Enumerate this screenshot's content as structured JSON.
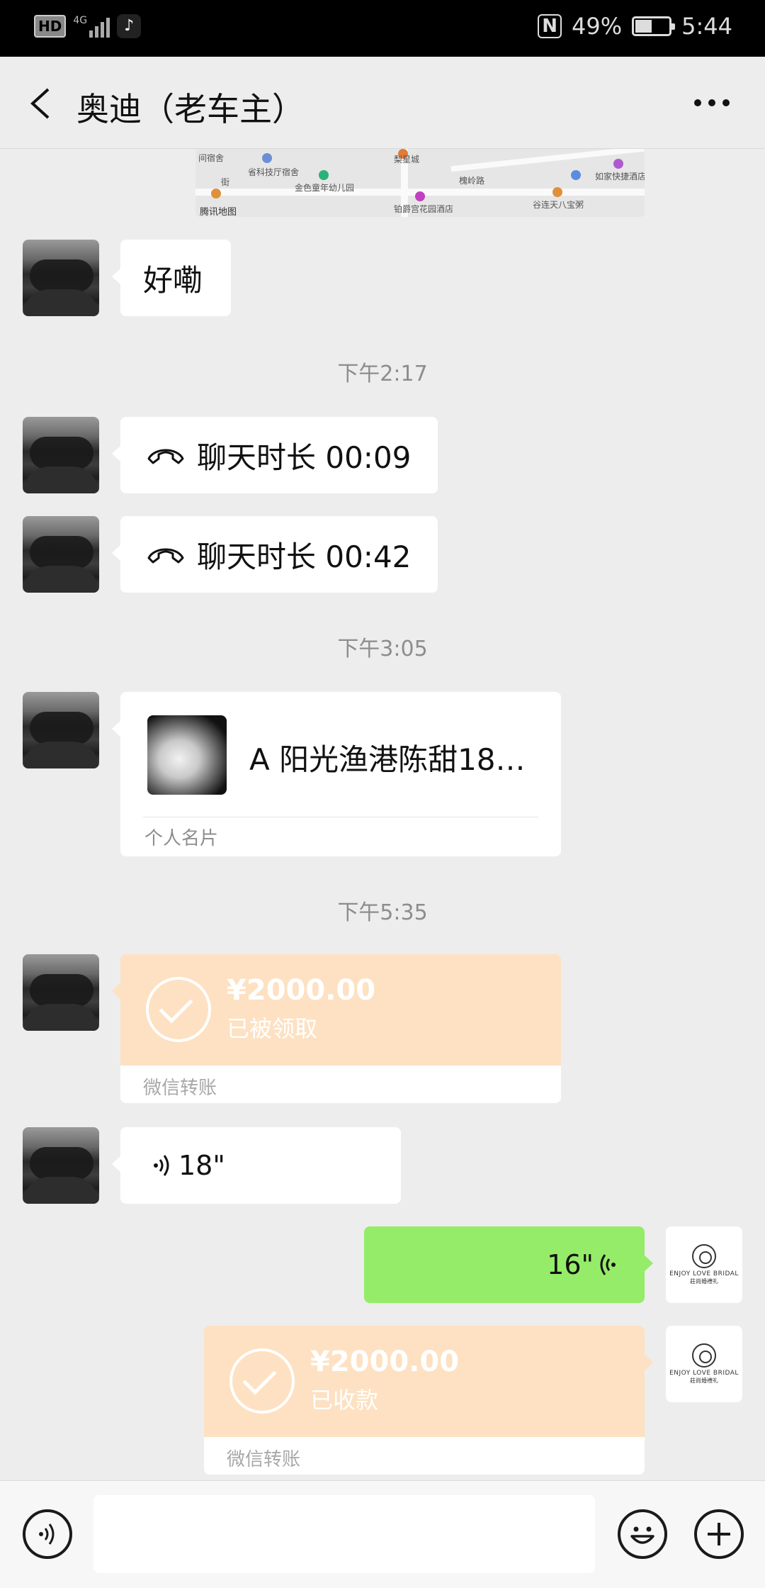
{
  "status_bar": {
    "hd": "HD",
    "network": "4G",
    "app_icon": "tiktok-icon",
    "nfc": "N",
    "battery": "49%",
    "battery_level": 0.49,
    "time": "5:44"
  },
  "header": {
    "title": "奥迪（老车主）",
    "back_icon": "back-arrow-icon",
    "more_icon": "more-icon"
  },
  "map_snippet": {
    "labels": [
      "间宿舍",
      "省科技厅宿舍",
      "金色童年幼儿园",
      "梨星城",
      "槐岭路",
      "如家快捷酒店",
      "腾讯地图",
      "铂爵宫花园酒店",
      "谷连天八宝粥",
      "街"
    ]
  },
  "messages": [
    {
      "type": "text",
      "side": "left",
      "text": "好嘞"
    },
    {
      "type": "timestamp",
      "text": "下午2:17"
    },
    {
      "type": "call",
      "side": "left",
      "text": "聊天时长 00:09"
    },
    {
      "type": "call",
      "side": "left",
      "text": "聊天时长 00:42"
    },
    {
      "type": "timestamp",
      "text": "下午3:05"
    },
    {
      "type": "contact_card",
      "side": "left",
      "name": "A 阳光渔港陈甜18…",
      "footer": "个人名片"
    },
    {
      "type": "timestamp",
      "text": "下午5:35"
    },
    {
      "type": "transfer",
      "side": "left",
      "amount": "¥2000.00",
      "status": "已被领取",
      "footer": "微信转账"
    },
    {
      "type": "voice",
      "side": "left",
      "duration": "18\""
    },
    {
      "type": "voice",
      "side": "right",
      "duration": "16\""
    },
    {
      "type": "transfer",
      "side": "right",
      "amount": "¥2000.00",
      "status": "已收款",
      "footer": "微信转账"
    }
  ],
  "my_avatar": {
    "logo_text": "ENJOY LOVE BRIDAL",
    "logo_sub": "莊尚婚禮礼"
  },
  "colors": {
    "background": "#ededed",
    "green_bubble": "#95ec69",
    "transfer_orange": "#fde1c2",
    "timestamp": "#8d8d8d"
  }
}
